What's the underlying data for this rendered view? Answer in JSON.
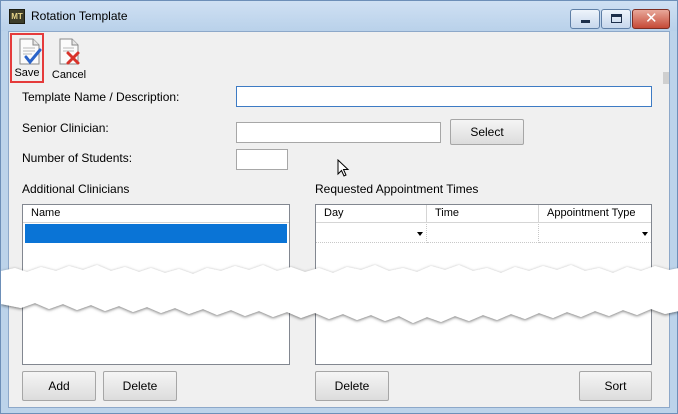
{
  "window": {
    "title": "Rotation Template",
    "app_icon_text": "MT"
  },
  "toolbar": {
    "save_label": "Save",
    "cancel_label": "Cancel"
  },
  "form": {
    "template_name_label": "Template Name / Description:",
    "template_name_value": "",
    "senior_clinician_label": "Senior Clinician:",
    "senior_clinician_value": "",
    "select_label": "Select",
    "num_students_label": "Number of Students:",
    "num_students_value": ""
  },
  "additional_clinicians": {
    "title": "Additional Clinicians",
    "columns": [
      "Name"
    ],
    "add_label": "Add",
    "delete_label": "Delete"
  },
  "appointments": {
    "title": "Requested Appointment Times",
    "columns": [
      "Day",
      "Time",
      "Appointment Type"
    ],
    "delete_label": "Delete",
    "sort_label": "Sort"
  },
  "colors": {
    "selection": "#0a74d6",
    "save_highlight": "#e53b3b",
    "client_bg": "#f0f0f0"
  }
}
